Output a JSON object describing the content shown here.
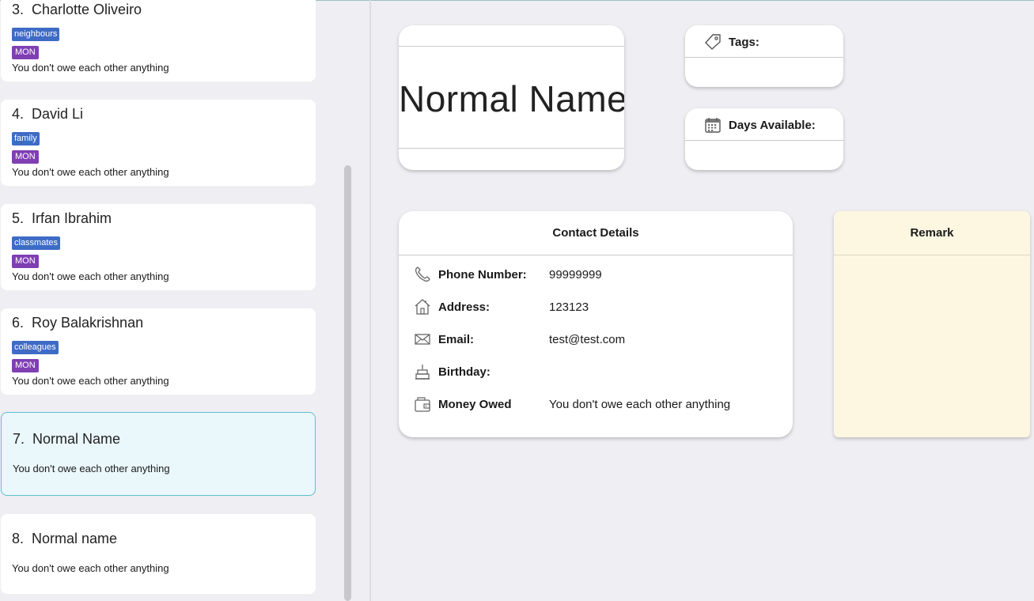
{
  "contacts": [
    {
      "index": "3.",
      "name": "Charlotte Oliveiro",
      "tag": "neighbours",
      "day": "MON",
      "money": "You don't owe each other anything"
    },
    {
      "index": "4.",
      "name": "David Li",
      "tag": "family",
      "day": "MON",
      "money": "You don't owe each other anything"
    },
    {
      "index": "5.",
      "name": "Irfan Ibrahim",
      "tag": "classmates",
      "day": "MON",
      "money": "You don't owe each other anything"
    },
    {
      "index": "6.",
      "name": "Roy Balakrishnan",
      "tag": "colleagues",
      "day": "MON",
      "money": "You don't owe each other anything"
    },
    {
      "index": "7.",
      "name": "Normal Name",
      "money": "You don't owe each other anything",
      "selected": true
    },
    {
      "index": "8.",
      "name": "Normal name",
      "money": "You don't owe each other anything"
    }
  ],
  "detail": {
    "name": "Normal Name",
    "tags_label": "Tags:",
    "days_label": "Days Available:",
    "contact_title": "Contact Details",
    "phone_label": "Phone Number:",
    "phone_value": "99999999",
    "address_label": "Address:",
    "address_value": "123123",
    "email_label": "Email:",
    "email_value": "test@test.com",
    "birthday_label": "Birthday:",
    "birthday_value": "",
    "money_label": "Money Owed",
    "money_value": "You don't owe each other anything",
    "remark_title": "Remark"
  },
  "colors": {
    "tag": "#3e6bc6",
    "day": "#7f3fb3",
    "selected_bg": "#eaf7fb",
    "selected_border": "#5fc0cf",
    "remark_bg": "#fdf7e2"
  },
  "icons": {
    "tags": "tag-icon",
    "days": "calendar-icon",
    "phone": "phone-icon",
    "address": "home-icon",
    "email": "mail-icon",
    "birthday": "cake-icon",
    "money": "wallet-icon"
  }
}
